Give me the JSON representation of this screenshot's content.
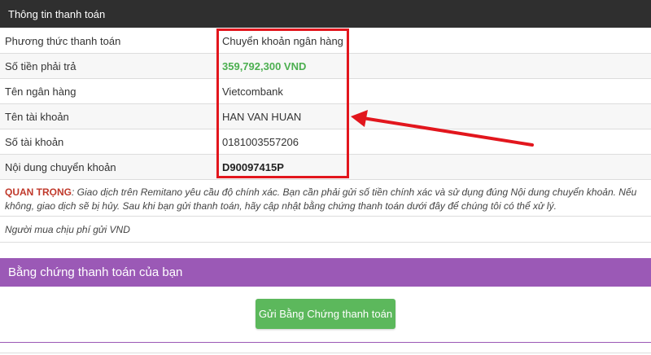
{
  "header": {
    "title": "Thông tin thanh toán"
  },
  "payment": {
    "rows": [
      {
        "label": "Phương thức thanh toán",
        "value": "Chuyển khoản ngân hàng"
      },
      {
        "label": "Số tiền phải trả",
        "value": "359,792,300 VND"
      },
      {
        "label": "Tên ngân hàng",
        "value": "Vietcombank"
      },
      {
        "label": "Tên tài khoản",
        "value": "HAN VAN HUAN"
      },
      {
        "label": "Số tài khoản",
        "value": "0181003557206"
      },
      {
        "label": "Nội dung chuyển khoản",
        "value": "D90097415P"
      }
    ]
  },
  "note": {
    "important_label": "QUAN TRỌNG",
    "text": ": Giao dịch trên Remitano yêu cầu độ chính xác. Bạn cần phải gửi số tiền chính xác và sử dụng đúng Nội dung chuyển khoản. Nếu không, giao dịch sẽ bị hủy. Sau khi bạn gửi thanh toán, hãy cập nhật bằng chứng thanh toán dưới đây để chúng tôi có thể xử lý."
  },
  "fee_note": "Người mua chịu phí gửi VND",
  "proof": {
    "title": "Bằng chứng thanh toán của bạn",
    "submit_label": "Gửi Bằng Chứng thanh toán"
  },
  "colors": {
    "header_bg": "#2f2f2f",
    "amount_green": "#4caf50",
    "highlight_red": "#e2161d",
    "proof_purple": "#9b59b6",
    "button_green": "#5cb85c"
  }
}
